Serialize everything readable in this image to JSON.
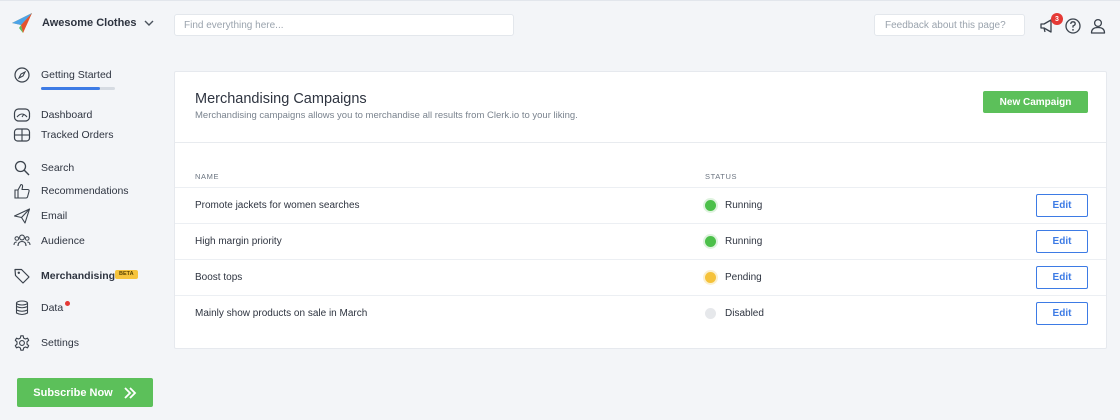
{
  "header": {
    "brand_name": "Awesome Clothes",
    "search_placeholder": "Find everything here...",
    "feedback_placeholder": "Feedback about this page?",
    "notification_count": "3"
  },
  "sidebar": {
    "items": [
      {
        "label": "Getting Started",
        "icon": "compass-icon"
      },
      {
        "label": "Dashboard",
        "icon": "dashboard-icon"
      },
      {
        "label": "Tracked Orders",
        "icon": "orders-icon"
      },
      {
        "label": "Search",
        "icon": "search-icon"
      },
      {
        "label": "Recommendations",
        "icon": "thumbs-up-icon"
      },
      {
        "label": "Email",
        "icon": "paper-plane-icon"
      },
      {
        "label": "Audience",
        "icon": "users-icon"
      },
      {
        "label": "Merchandising",
        "icon": "tag-icon",
        "active": true,
        "badge": "BETA"
      },
      {
        "label": "Data",
        "icon": "database-icon"
      },
      {
        "label": "Settings",
        "icon": "gear-icon"
      }
    ],
    "getting_started_progress": 0.8,
    "subscribe_label": "Subscribe Now"
  },
  "main": {
    "title": "Merchandising Campaigns",
    "subtitle": "Merchandising campaigns allows you to merchandise all results from Clerk.io to your liking.",
    "new_campaign_label": "New Campaign",
    "columns": {
      "name": "NAME",
      "status": "STATUS"
    },
    "edit_label": "Edit",
    "rows": [
      {
        "name": "Promote jackets for women searches",
        "status": "Running"
      },
      {
        "name": "High margin priority",
        "status": "Running"
      },
      {
        "name": "Boost tops",
        "status": "Pending"
      },
      {
        "name": "Mainly show products on sale in March",
        "status": "Disabled"
      }
    ]
  },
  "colors": {
    "accent_green": "#5cc05a",
    "accent_blue": "#3d7be5",
    "status_running": "#4cc04a",
    "status_pending": "#f5c23a",
    "status_disabled": "#e6e8eb",
    "badge_red": "#e53935"
  }
}
